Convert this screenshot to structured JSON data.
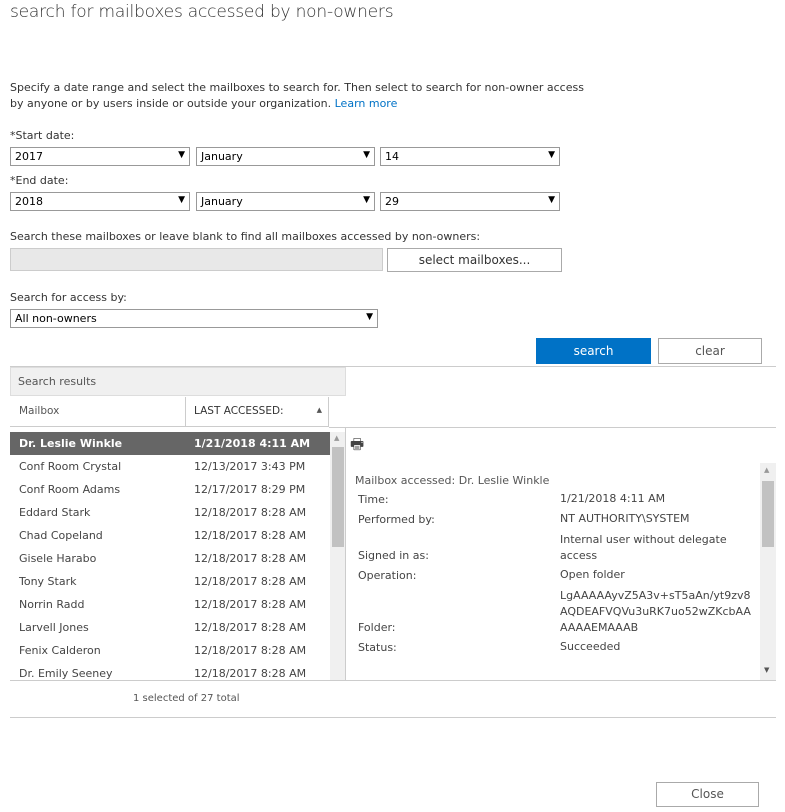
{
  "title": "search for mailboxes accessed by non-owners",
  "description": "Specify a date range and select the mailboxes to search for. Then select to search for non-owner access by anyone or by users inside or outside your organization.",
  "learn_more": "Learn more",
  "start_date": {
    "label": "*Start date:",
    "year": "2017",
    "month": "January",
    "day": "14"
  },
  "end_date": {
    "label": "*End date:",
    "year": "2018",
    "month": "January",
    "day": "29"
  },
  "mailboxes": {
    "label": "Search these mailboxes or leave blank to find all mailboxes accessed by non-owners:",
    "value": "",
    "button": "select mailboxes..."
  },
  "access": {
    "label": "Search for access by:",
    "value": "All non-owners"
  },
  "search_label": "search",
  "clear_label": "clear",
  "results": {
    "header": "Search results",
    "columns": [
      "Mailbox",
      "LAST ACCESSED:"
    ],
    "rows": [
      {
        "mailbox": "Dr. Leslie Winkle",
        "date": "1/21/2018 4:11 AM",
        "selected": true
      },
      {
        "mailbox": "Conf Room Crystal",
        "date": "12/13/2017 3:43 PM"
      },
      {
        "mailbox": "Conf Room Adams",
        "date": "12/17/2017 8:29 PM"
      },
      {
        "mailbox": "Eddard Stark",
        "date": "12/18/2017 8:28 AM"
      },
      {
        "mailbox": "Chad Copeland",
        "date": "12/18/2017 8:28 AM"
      },
      {
        "mailbox": "Gisele Harabo",
        "date": "12/18/2017 8:28 AM"
      },
      {
        "mailbox": "Tony Stark",
        "date": "12/18/2017 8:28 AM"
      },
      {
        "mailbox": "Norrin Radd",
        "date": "12/18/2017 8:28 AM"
      },
      {
        "mailbox": "Larvell Jones",
        "date": "12/18/2017 8:28 AM"
      },
      {
        "mailbox": "Fenix Calderon",
        "date": "12/18/2017 8:28 AM"
      },
      {
        "mailbox": "Dr. Emily Seeney",
        "date": "12/18/2017 8:28 AM"
      }
    ],
    "footer": "1 selected of 27 total"
  },
  "details": {
    "heading": "Mailbox accessed: Dr. Leslie Winkle",
    "time_label": "Time:",
    "time": "1/21/2018 4:11 AM",
    "performed_label": "Performed by:",
    "performed": "NT AUTHORITY\\SYSTEM",
    "signed_label": "Signed in as:",
    "signed": "Internal user without delegate access",
    "operation_label": "Operation:",
    "operation": "Open folder",
    "folder_label": "Folder:",
    "folder": "LgAAAAAyvZ5A3v+sT5aAn/yt9zv8 AQDEAFVQVu3uRK7uo52wZKcbAA AAAAEMAAAB",
    "status_label": "Status:",
    "status": "Succeeded"
  },
  "close_label": "Close",
  "colors": {
    "accent": "#0072c6",
    "selected_row": "#666666"
  }
}
